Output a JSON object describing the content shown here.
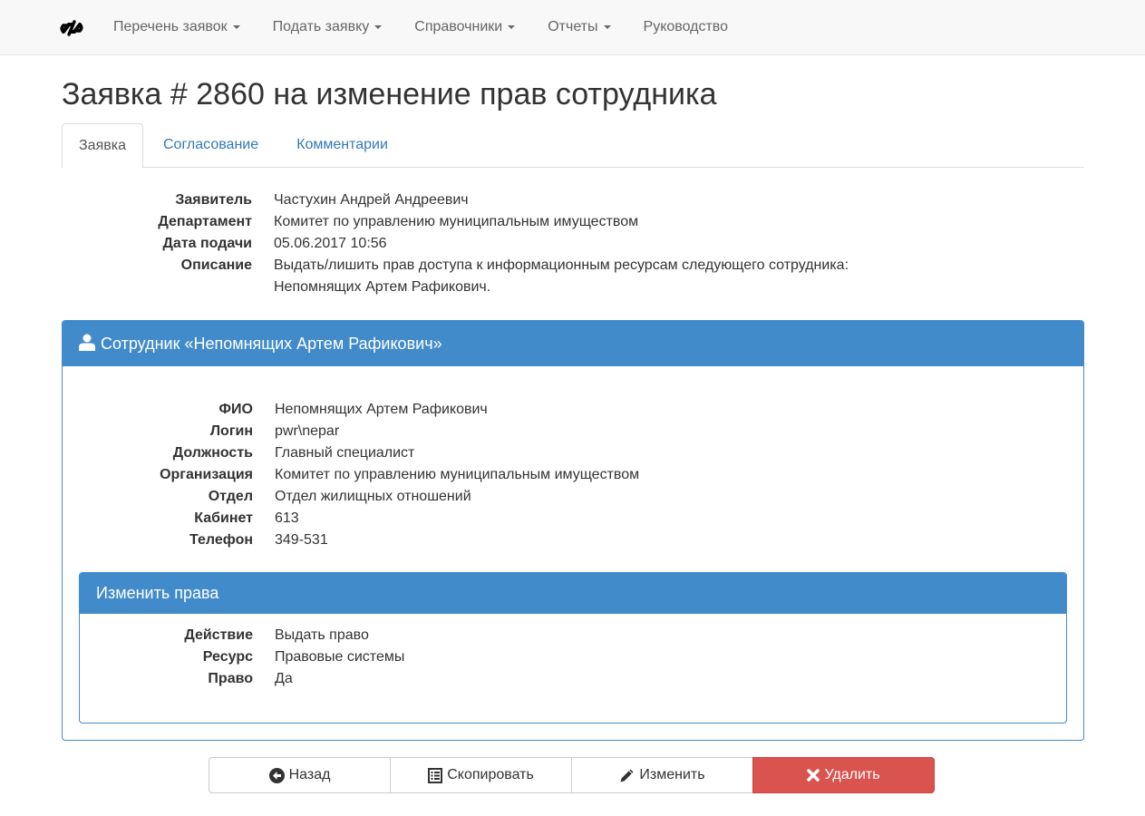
{
  "navbar": {
    "brand_icon": "logo-slash-icon",
    "items": [
      {
        "label": "Перечень заявок",
        "dropdown": true
      },
      {
        "label": "Подать заявку",
        "dropdown": true
      },
      {
        "label": "Справочники",
        "dropdown": true
      },
      {
        "label": "Отчеты",
        "dropdown": true
      },
      {
        "label": "Руководство",
        "dropdown": false
      }
    ]
  },
  "page": {
    "title": "Заявка # 2860 на изменение прав сотрудника"
  },
  "tabs": [
    {
      "label": "Заявка",
      "active": true
    },
    {
      "label": "Согласование",
      "active": false
    },
    {
      "label": "Комментарии",
      "active": false
    }
  ],
  "request": {
    "applicant": {
      "label": "Заявитель",
      "value": "Частухин Андрей Андреевич"
    },
    "department": {
      "label": "Департамент",
      "value": "Комитет по управлению муниципальным имуществом"
    },
    "date": {
      "label": "Дата подачи",
      "value": "05.06.2017 10:56"
    },
    "description": {
      "label": "Описание",
      "line1": "Выдать/лишить прав доступа к информационным ресурсам следующего сотрудника:",
      "line2": "Непомнящих Артем Рафикович."
    }
  },
  "employee_panel": {
    "icon": "user-icon",
    "title": "Сотрудник «Непомнящих Артем Рафикович»",
    "fields": [
      {
        "label": "ФИО",
        "value": "Непомнящих Артем Рафикович"
      },
      {
        "label": "Логин",
        "value": "pwr\\nepar"
      },
      {
        "label": "Должность",
        "value": "Главный специалист"
      },
      {
        "label": "Организация",
        "value": "Комитет по управлению муниципальным имуществом"
      },
      {
        "label": "Отдел",
        "value": "Отдел жилищных отношений"
      },
      {
        "label": "Кабинет",
        "value": "613"
      },
      {
        "label": "Телефон",
        "value": "349-531"
      }
    ]
  },
  "rights_panel": {
    "title": "Изменить права",
    "fields": [
      {
        "label": "Действие",
        "value": "Выдать право"
      },
      {
        "label": "Ресурс",
        "value": "Правовые системы"
      },
      {
        "label": "Право",
        "value": "Да"
      }
    ]
  },
  "actions": {
    "back": {
      "label": "Назад",
      "icon": "circle-arrow-left-icon"
    },
    "copy": {
      "label": "Скопировать",
      "icon": "list-alt-icon"
    },
    "edit": {
      "label": "Изменить",
      "icon": "pencil-icon"
    },
    "delete": {
      "label": "Удалить",
      "icon": "remove-icon"
    }
  },
  "colors": {
    "primary": "#428bca",
    "danger": "#d9534f",
    "link": "#337ab7"
  }
}
